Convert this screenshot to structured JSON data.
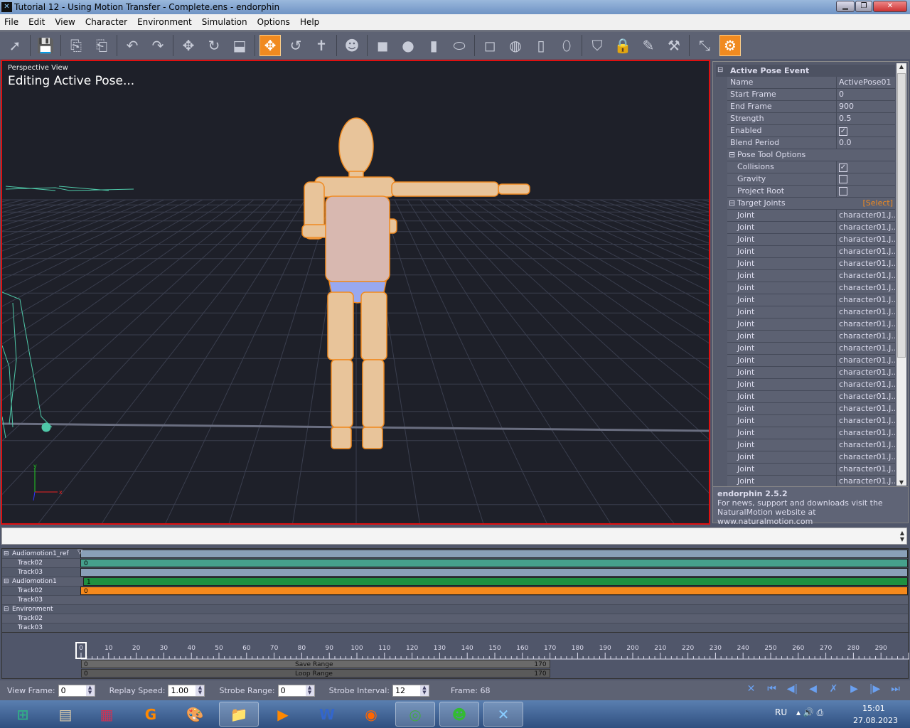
{
  "window": {
    "title": "Tutorial 12 - Using Motion Transfer - Complete.ens - endorphin"
  },
  "menu": [
    "File",
    "Edit",
    "View",
    "Character",
    "Environment",
    "Simulation",
    "Options",
    "Help"
  ],
  "toolbar": [
    {
      "icon": "select-arrow-icon",
      "g": "➚"
    },
    {
      "sep": true
    },
    {
      "icon": "save-icon",
      "g": "💾"
    },
    {
      "sep": true
    },
    {
      "icon": "import-icon",
      "g": "⎘"
    },
    {
      "icon": "export-icon",
      "g": "⎗"
    },
    {
      "sep": true
    },
    {
      "icon": "undo-icon",
      "g": "↶"
    },
    {
      "icon": "redo-icon",
      "g": "↷"
    },
    {
      "sep": true
    },
    {
      "icon": "move-icon",
      "g": "✥"
    },
    {
      "icon": "rotate-icon",
      "g": "↻"
    },
    {
      "icon": "scale-icon",
      "g": "⬓"
    },
    {
      "sep": true
    },
    {
      "icon": "pose-move-icon",
      "g": "✥",
      "active": true
    },
    {
      "icon": "pose-rotate-icon",
      "g": "↺"
    },
    {
      "icon": "character-icon",
      "g": "✝"
    },
    {
      "sep": true
    },
    {
      "icon": "head-icon",
      "g": "☻"
    },
    {
      "sep": true
    },
    {
      "icon": "box-icon",
      "g": "◼"
    },
    {
      "icon": "sphere-icon",
      "g": "●"
    },
    {
      "icon": "cylinder-icon",
      "g": "▮"
    },
    {
      "icon": "capsule-icon",
      "g": "⬭"
    },
    {
      "sep": true
    },
    {
      "icon": "box-wire-icon",
      "g": "◻"
    },
    {
      "icon": "sphere-wire-icon",
      "g": "◍"
    },
    {
      "icon": "cylinder-wire-icon",
      "g": "▯"
    },
    {
      "icon": "capsule-wire-icon",
      "g": "⬯"
    },
    {
      "sep": true
    },
    {
      "icon": "shield-icon",
      "g": "⛉"
    },
    {
      "icon": "lock-icon",
      "g": "🔒"
    },
    {
      "icon": "brush-icon",
      "g": "✎"
    },
    {
      "icon": "hammer-icon",
      "g": "⚒"
    },
    {
      "sep": true
    },
    {
      "icon": "resize-icon",
      "g": "⤡"
    },
    {
      "icon": "camera-icon",
      "g": "⚙",
      "active": true
    }
  ],
  "viewport": {
    "label": "Perspective View",
    "status": "Editing Active Pose...",
    "axis_x": "x",
    "axis_y": "y"
  },
  "props": {
    "section": "Active Pose Event",
    "rows": [
      {
        "k": "Name",
        "v": "ActivePose01"
      },
      {
        "k": "Start Frame",
        "v": "0"
      },
      {
        "k": "End Frame",
        "v": "900"
      },
      {
        "k": "Strength",
        "v": "0.5"
      },
      {
        "k": "Enabled",
        "check": true
      },
      {
        "k": "Blend Period",
        "v": "0.0"
      }
    ],
    "pose_tool": "Pose Tool Options",
    "pose_rows": [
      {
        "k": "Collisions",
        "check": true
      },
      {
        "k": "Gravity",
        "check": false
      },
      {
        "k": "Project Root",
        "check": false
      }
    ],
    "target": "Target Joints",
    "select": "[Select]",
    "joint_label": "Joint",
    "joint_value": "character01.J...",
    "joint_count": 23,
    "footer_title": "endorphin 2.5.2",
    "footer_line1": "For news, support and downloads visit the",
    "footer_line2": "NaturalMotion website at www.naturalmotion.com"
  },
  "timeline": {
    "groups": [
      {
        "name": "Audiomotion1_ref",
        "tracks": [
          "Track02",
          "Track03"
        ]
      },
      {
        "name": "Audiomotion1",
        "tracks": [
          "Track02",
          "Track03"
        ]
      },
      {
        "name": "Environment",
        "tracks": [
          "Track02",
          "Track03"
        ]
      }
    ],
    "bars": [
      {
        "row": 0,
        "color": "#8aa0b8",
        "label": ""
      },
      {
        "row": 1,
        "color": "#46a08c",
        "label": "0"
      },
      {
        "row": 2,
        "color": "#8aa0b8",
        "label": ""
      },
      {
        "row": 3,
        "color": "#1f9040",
        "label": "1"
      },
      {
        "row": 4,
        "color": "#f5891c",
        "label": "0"
      }
    ],
    "ruler_ticks": [
      0,
      10,
      20,
      30,
      40,
      50,
      60,
      70,
      80,
      90,
      100,
      110,
      120,
      130,
      140,
      150,
      160,
      170,
      180,
      190,
      200,
      210,
      220,
      230,
      240,
      250,
      260,
      270,
      280,
      290
    ],
    "save_range": {
      "label": "Save Range",
      "start": "0",
      "end": "170"
    },
    "loop_range": {
      "label": "Loop Range",
      "start": "0",
      "end": "170"
    }
  },
  "controls": {
    "view_frame_label": "View Frame:",
    "view_frame": "0",
    "replay_label": "Replay Speed:",
    "replay": "1.00",
    "strobe_range_label": "Strobe Range:",
    "strobe_range": "0",
    "strobe_interval_label": "Strobe Interval:",
    "strobe_interval": "12",
    "frame": "Frame: 68",
    "playback": [
      {
        "icon": "stop-icon",
        "g": "✕"
      },
      {
        "icon": "first-frame-icon",
        "g": "⏮"
      },
      {
        "icon": "step-back-icon",
        "g": "◀|"
      },
      {
        "icon": "play-back-icon",
        "g": "◀"
      },
      {
        "icon": "loop-icon",
        "g": "✗"
      },
      {
        "icon": "play-icon",
        "g": "▶"
      },
      {
        "icon": "step-forward-icon",
        "g": "|▶"
      },
      {
        "icon": "last-frame-icon",
        "g": "⏭"
      }
    ]
  },
  "taskbar": {
    "apps": [
      {
        "icon": "start-orb-icon",
        "g": "⊞",
        "c": "#3a8"
      },
      {
        "icon": "scanner-app-icon",
        "g": "▤",
        "c": "#dca"
      },
      {
        "icon": "winrar-icon",
        "g": "▦",
        "c": "#c35"
      },
      {
        "icon": "g-app-icon",
        "g": "G",
        "c": "#f80"
      },
      {
        "icon": "paint-icon",
        "g": "🎨",
        "c": "#fc8"
      },
      {
        "icon": "explorer-icon",
        "g": "📁",
        "c": "#fd6",
        "open": true
      },
      {
        "icon": "media-player-icon",
        "g": "▶",
        "c": "#f80"
      },
      {
        "icon": "word-icon",
        "g": "W",
        "c": "#36c"
      },
      {
        "icon": "firefox-icon",
        "g": "◉",
        "c": "#f60"
      },
      {
        "icon": "chrome-icon",
        "g": "◎",
        "c": "#4a4",
        "open": true
      },
      {
        "icon": "green-app-icon",
        "g": "☻",
        "c": "#3b3",
        "open": true
      },
      {
        "icon": "endorphin-icon",
        "g": "✕",
        "c": "#8cf",
        "open": true
      }
    ],
    "lang": "RU",
    "time": "15:01",
    "date": "27.08.2023"
  }
}
